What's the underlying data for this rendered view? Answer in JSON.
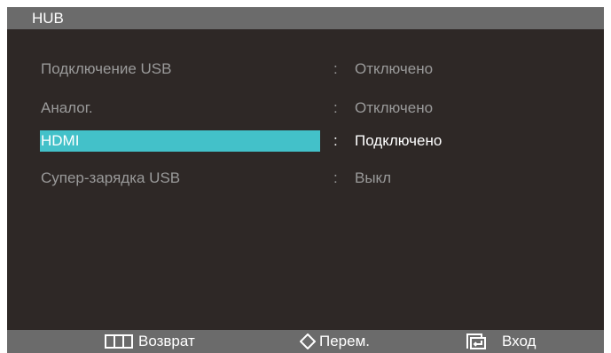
{
  "header": {
    "title": "HUB"
  },
  "menu": {
    "items": [
      {
        "label": "Подключение USB",
        "separator": ":",
        "value": "Отключено",
        "selected": false
      },
      {
        "label": "Аналог.",
        "separator": ":",
        "value": "Отключено",
        "selected": false
      },
      {
        "label": "HDMI",
        "separator": ":",
        "value": "Подключено",
        "selected": true
      },
      {
        "label": "Супер-зарядка USB",
        "separator": ":",
        "value": "Выкл",
        "selected": false
      }
    ]
  },
  "footer": {
    "buttons": [
      {
        "icon": "menu-bars-icon",
        "label": "Возврат"
      },
      {
        "icon": "diamond-nav-icon",
        "label": "Перем."
      },
      {
        "icon": "enter-source-icon",
        "label": "Вход"
      }
    ]
  },
  "colors": {
    "background": "#2e2826",
    "bar": "#6b6b6b",
    "highlight": "#43c1c9",
    "text_dim": "#9a9a9a",
    "text_active": "#ffffff"
  }
}
